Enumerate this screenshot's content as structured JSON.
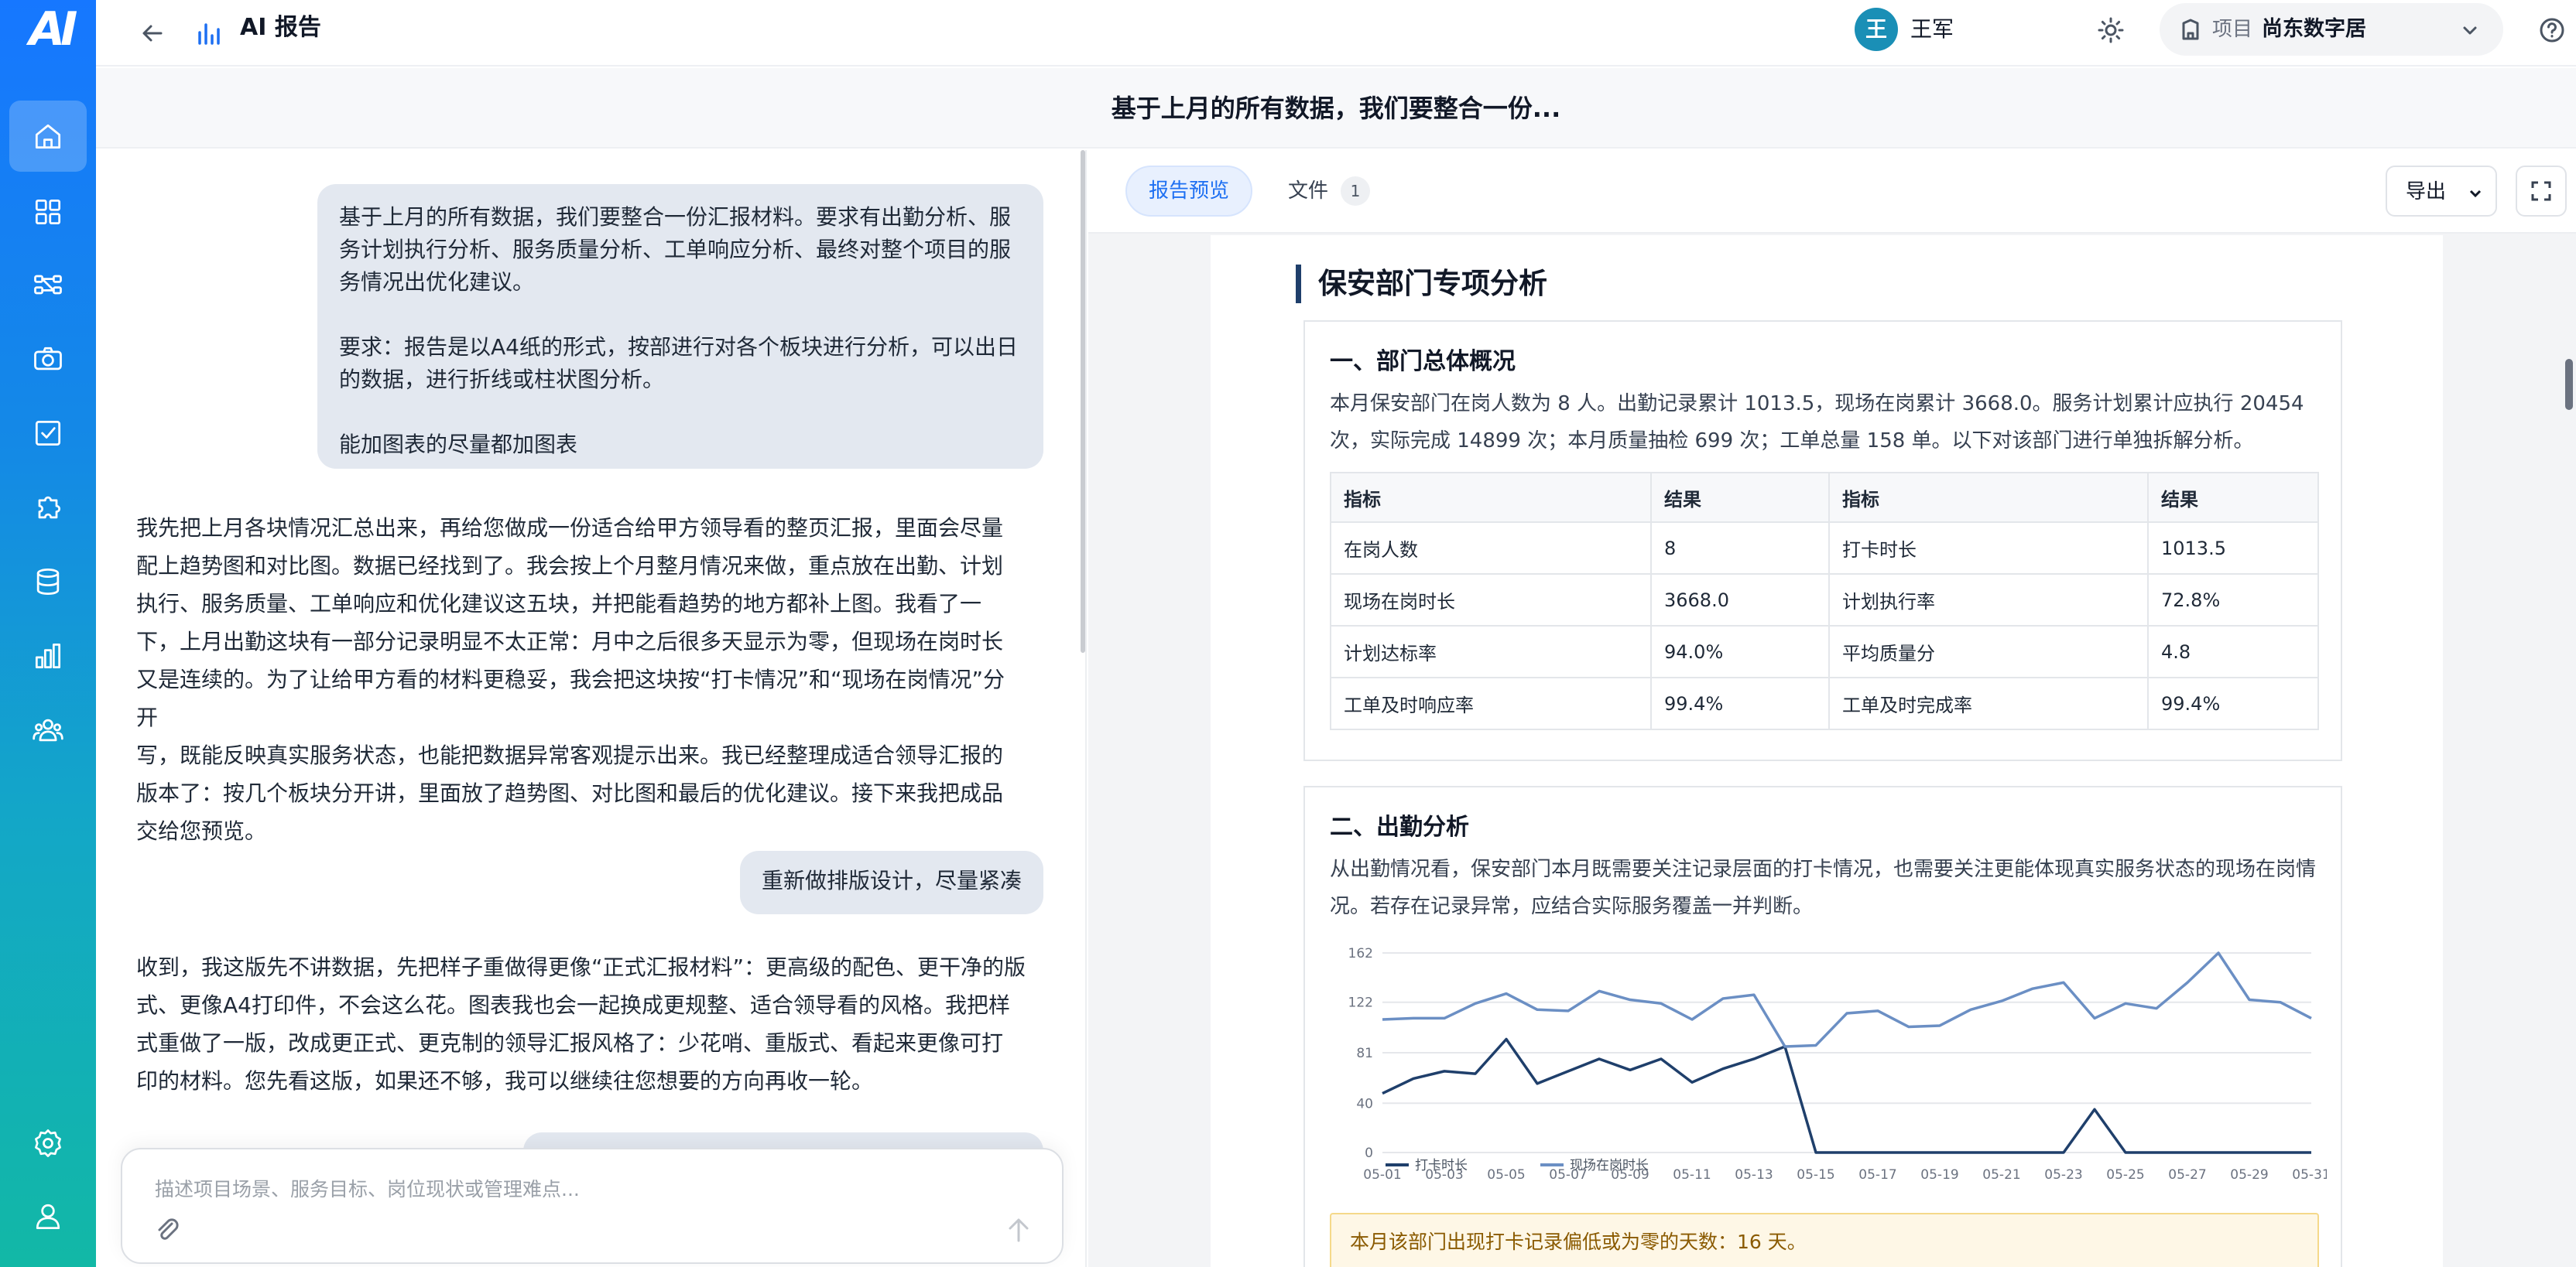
{
  "app": {
    "logo_text": "AI",
    "title": "AI 报告",
    "user": {
      "avatar_initial": "王",
      "name": "王军"
    },
    "project": {
      "label": "项目",
      "value": "尚东数字居"
    }
  },
  "sidebar": {
    "items": [
      {
        "name": "home",
        "active": true
      },
      {
        "name": "grid"
      },
      {
        "name": "workflow"
      },
      {
        "name": "camera"
      },
      {
        "name": "tasks"
      },
      {
        "name": "puzzle"
      },
      {
        "name": "database"
      },
      {
        "name": "analytics"
      },
      {
        "name": "team"
      }
    ],
    "bottom": [
      {
        "name": "settings"
      },
      {
        "name": "profile"
      }
    ]
  },
  "conversation": {
    "title": "基于上月的所有数据，我们要整合一份...",
    "messages": [
      {
        "role": "user",
        "lines": [
          "基于上月的所有数据，我们要整合一份汇报材料。要求有出勤分析、服",
          "务计划执行分析、服务质量分析、工单响应分析、最终对整个项目的服",
          "务情况出优化建议。",
          "",
          "要求：报告是以A4纸的形式，按部进行对各个板块进行分析，可以出日",
          "的数据，进行折线或柱状图分析。",
          "",
          "能加图表的尽量都加图表"
        ]
      },
      {
        "role": "assistant",
        "lines": [
          "我先把上月各块情况汇总出来，再给您做成一份适合给甲方领导看的整页汇报，里面会尽量",
          "配上趋势图和对比图。数据已经找到了。我会按上个月整月情况来做，重点放在出勤、计划",
          "执行、服务质量、工单响应和优化建议这五块，并把能看趋势的地方都补上图。我看了一",
          "下，上月出勤这块有一部分记录明显不太正常：月中之后很多天显示为零，但现场在岗时长",
          "又是连续的。为了让给甲方看的材料更稳妥，我会把这块按“打卡情况”和“现场在岗情况”分开",
          "写，既能反映真实服务状态，也能把数据异常客观提示出来。我已经整理成适合领导汇报的",
          "版本了：按几个板块分开讲，里面放了趋势图、对比图和最后的优化建议。接下来我把成品",
          "交给您预览。"
        ]
      },
      {
        "role": "user",
        "lines": [
          "重新做排版设计，尽量紧凑"
        ]
      },
      {
        "role": "assistant",
        "lines": [
          "收到，我这版先不讲数据，先把样子重做得更像“正式汇报材料”：更高级的配色、更干净的版",
          "式、更像A4打印件，不会这么花。图表我也会一起换成更规整、适合领导看的风格。我把样",
          "式重做了一版，改成更正式、更克制的领导汇报风格了：少花哨、重版式、看起来更像可打",
          "印的材料。您先看这版，如果还不够，我可以继续往您想要的方向再收一轮。"
        ]
      }
    ],
    "input_placeholder": "描述项目场景、服务目标、岗位现状或管理难点..."
  },
  "report_panel": {
    "tabs": {
      "preview": "报告预览",
      "files": "文件",
      "files_count": "1"
    },
    "export_label": "导出",
    "section_title": "保安部门专项分析",
    "overview": {
      "title": "一、部门总体概况",
      "text_lines": [
        "本月保安部门在岗人数为 8 人。出勤记录累计 1013.5，现场在岗累计 3668.0。服务计划累计应执行 20454",
        "次，实际完成 14899 次；本月质量抽检 699 次；工单总量 158 单。以下对该部门进行单独拆解分析。"
      ],
      "table": {
        "headers": [
          "指标",
          "结果",
          "指标",
          "结果"
        ],
        "rows": [
          [
            "在岗人数",
            "8",
            "打卡时长",
            "1013.5"
          ],
          [
            "现场在岗时长",
            "3668.0",
            "计划执行率",
            "72.8%"
          ],
          [
            "计划达标率",
            "94.0%",
            "平均质量分",
            "4.8"
          ],
          [
            "工单及时响应率",
            "99.4%",
            "工单及时完成率",
            "99.4%"
          ]
        ]
      }
    },
    "attendance": {
      "title": "二、出勤分析",
      "text_lines": [
        "从出勤情况看，保安部门本月既需要关注记录层面的打卡情况，也需要关注更能体现真实服务状态的现场在岗情",
        "况。若存在记录异常，应结合实际服务覆盖一并判断。"
      ],
      "alert": "本月该部门出现打卡记录偏低或为零的天数：16 天。"
    }
  },
  "chart_data": {
    "type": "line",
    "x": [
      "05-01",
      "05-02",
      "05-03",
      "05-04",
      "05-05",
      "05-06",
      "05-07",
      "05-08",
      "05-09",
      "05-10",
      "05-11",
      "05-12",
      "05-13",
      "05-14",
      "05-15",
      "05-16",
      "05-17",
      "05-18",
      "05-19",
      "05-20",
      "05-21",
      "05-22",
      "05-23",
      "05-24",
      "05-25",
      "05-26",
      "05-27",
      "05-28",
      "05-29",
      "05-30",
      "05-31"
    ],
    "x_tick_labels": [
      "05-01",
      "05-03",
      "05-05",
      "05-07",
      "05-09",
      "05-11",
      "05-13",
      "05-15",
      "05-17",
      "05-19",
      "05-21",
      "05-23",
      "05-25",
      "05-27",
      "05-29",
      "05-31"
    ],
    "yticks": [
      0,
      40,
      81,
      122,
      162
    ],
    "ylim": [
      0,
      162
    ],
    "grid": true,
    "legend_position": "bottom-left",
    "series": [
      {
        "name": "打卡时长",
        "color": "#1f3f6b",
        "values": [
          48,
          60,
          66,
          64,
          92,
          56,
          66,
          76,
          67,
          76,
          57,
          68,
          76,
          86,
          0,
          0,
          0,
          0,
          0,
          0,
          0,
          0,
          0,
          35,
          0,
          0,
          0,
          0,
          0,
          0,
          0
        ]
      },
      {
        "name": "现场在岗时长",
        "color": "#6b8fc4",
        "values": [
          108,
          109,
          109,
          121,
          129,
          116,
          115,
          131,
          124,
          121,
          108,
          125,
          128,
          86,
          87,
          113,
          115,
          102,
          103,
          116,
          123,
          133,
          138,
          109,
          121,
          117,
          138,
          162,
          124,
          122,
          109
        ]
      }
    ]
  }
}
